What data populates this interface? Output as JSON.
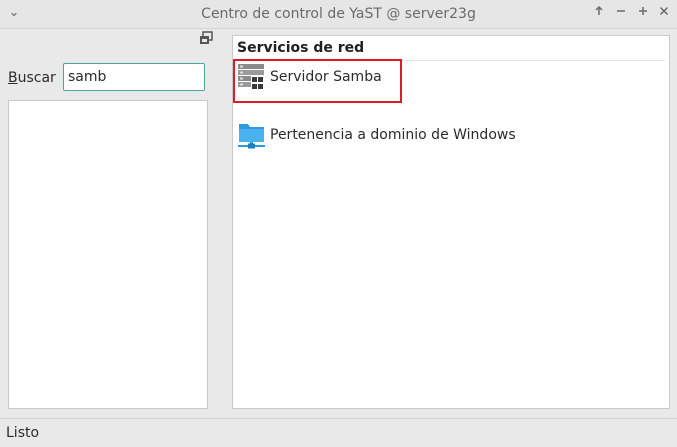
{
  "window": {
    "title": "Centro de control de YaST @ server23g",
    "buttons": [
      "menu",
      "keep-above",
      "minimize",
      "maximize",
      "close"
    ]
  },
  "search": {
    "label_prefix": "B",
    "label_rest": "uscar",
    "value": "samb"
  },
  "section": {
    "title": "Servicios de red",
    "modules": [
      {
        "label": "Servidor Samba",
        "icon": "server-icon",
        "highlighted": true
      },
      {
        "label": "Pertenencia a dominio de Windows",
        "icon": "network-folder-icon",
        "highlighted": false
      }
    ]
  },
  "status": {
    "text": "Listo"
  },
  "colors": {
    "highlight": "#e01b24",
    "input_focus": "#4fa59a",
    "folder_blue": "#2a9be0"
  }
}
